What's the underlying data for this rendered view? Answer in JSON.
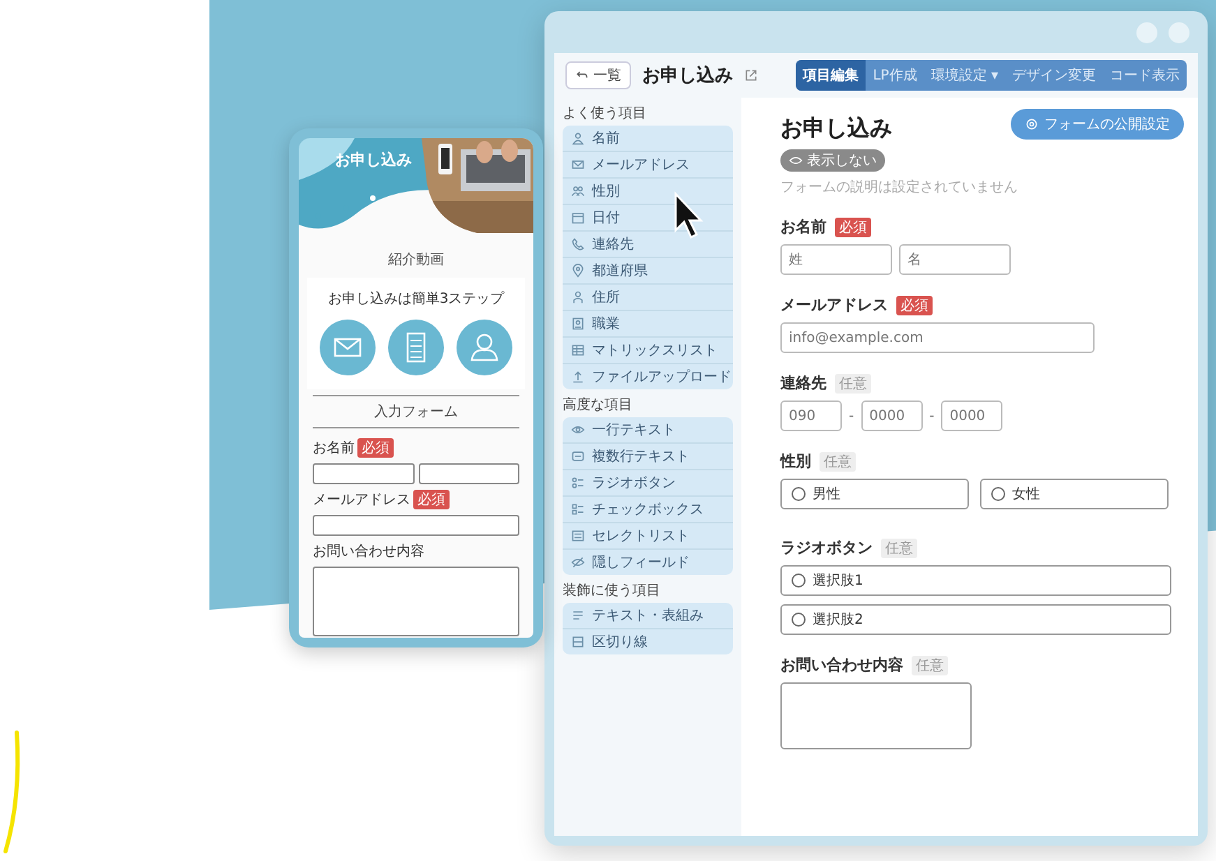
{
  "mobile_preview": {
    "header_title": "お申し込み",
    "video_label": "紹介動画",
    "steps_title": "お申し込みは簡単3ステップ",
    "form_heading": "入力フォーム",
    "fields": [
      {
        "label": "お名前",
        "badge": "必須",
        "kind": "double"
      },
      {
        "label": "メールアドレス",
        "badge": "必須",
        "kind": "single"
      },
      {
        "label": "お問い合わせ内容",
        "kind": "textarea"
      }
    ]
  },
  "editor": {
    "back_button": "一覧",
    "title": "お申し込み",
    "tabs": [
      {
        "label": "項目編集",
        "selected": true
      },
      {
        "label": "LP作成",
        "selected": false
      },
      {
        "label": "環境設定 ▾",
        "selected": false
      },
      {
        "label": "デザイン変更",
        "selected": false
      },
      {
        "label": "コード表示",
        "selected": false
      }
    ],
    "palette": [
      {
        "heading": "よく使う項目",
        "items": [
          "名前",
          "メールアドレス",
          "性別",
          "日付",
          "連絡先",
          "都道府県",
          "住所",
          "職業",
          "マトリックスリスト",
          "ファイルアップロード"
        ]
      },
      {
        "heading": "高度な項目",
        "items": [
          "一行テキスト",
          "複数行テキスト",
          "ラジオボタン",
          "チェックボックス",
          "セレクトリスト",
          "隠しフィールド"
        ]
      },
      {
        "heading": "装飾に使う項目",
        "items": [
          "テキスト・表組み",
          "区切り線"
        ]
      }
    ],
    "form": {
      "title": "お申し込み",
      "visibility_badge": "表示しない",
      "description": "フォームの説明は設定されていません",
      "publish_button": "フォームの公開設定",
      "fields": [
        {
          "label": "お名前",
          "badge": "必須",
          "required": true,
          "kind": "text",
          "inputs": [
            {
              "placeholder": "姓"
            },
            {
              "placeholder": "名"
            }
          ]
        },
        {
          "label": "メールアドレス",
          "badge": "必須",
          "required": true,
          "kind": "email",
          "inputs": [
            {
              "placeholder": "info@example.com"
            }
          ]
        },
        {
          "label": "連絡先",
          "badge": "任意",
          "required": false,
          "kind": "phone",
          "inputs": [
            {
              "placeholder": "090"
            },
            {
              "placeholder": "0000"
            },
            {
              "placeholder": "0000"
            }
          ],
          "separator": "-"
        },
        {
          "label": "性別",
          "badge": "任意",
          "required": false,
          "kind": "radio_row",
          "options": [
            "男性",
            "女性"
          ]
        },
        {
          "label": "ラジオボタン",
          "badge": "任意",
          "required": false,
          "kind": "radio_list",
          "options": [
            "選択肢1",
            "選択肢2"
          ]
        },
        {
          "label": "お問い合わせ内容",
          "badge": "任意",
          "required": false,
          "kind": "textarea"
        }
      ]
    }
  }
}
